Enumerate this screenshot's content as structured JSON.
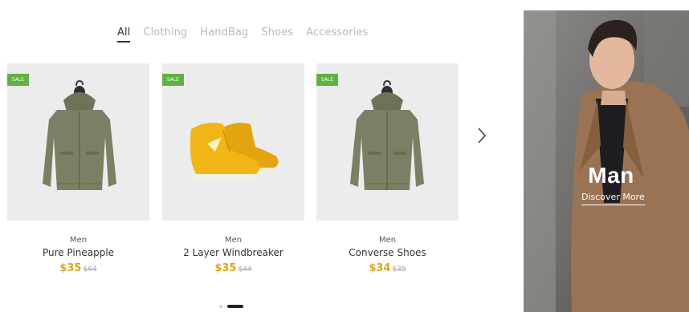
{
  "tabs": [
    {
      "label": "All",
      "active": true
    },
    {
      "label": "Clothing",
      "active": false
    },
    {
      "label": "HandBag",
      "active": false
    },
    {
      "label": "Shoes",
      "active": false
    },
    {
      "label": "Accessories",
      "active": false
    }
  ],
  "products": [
    {
      "badge": "SALE",
      "category": "Men",
      "name": "Pure Pineapple",
      "price": "$35",
      "old_price": "$64",
      "image": "olive-jacket"
    },
    {
      "badge": "SALE",
      "category": "Men",
      "name": "2 Layer Windbreaker",
      "price": "$35",
      "old_price": "$44",
      "image": "yellow-sneakers"
    },
    {
      "badge": "SALE",
      "category": "Men",
      "name": "Converse Shoes",
      "price": "$34",
      "old_price": "$35",
      "image": "olive-jacket"
    }
  ],
  "carousel": {
    "next_icon": "chevron-right-icon",
    "slide_count": 2,
    "active_slide": 2
  },
  "banner": {
    "title": "Man",
    "link": "Discover More"
  },
  "colors": {
    "sale_badge": "#5fb142",
    "price": "#e0a51e",
    "card_bg": "#ececec",
    "tab_inactive": "#b9b9b9"
  }
}
